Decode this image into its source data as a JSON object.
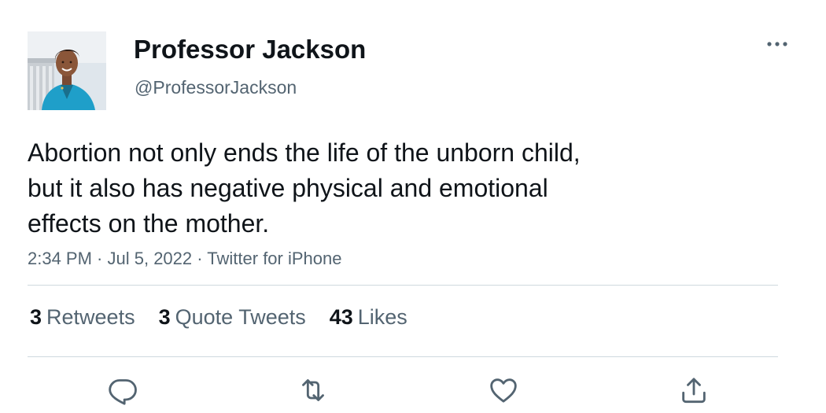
{
  "user": {
    "display_name": "Professor Jackson",
    "handle": "@ProfessorJackson"
  },
  "tweet": {
    "text": "Abortion not only ends the life of the unborn child,\nbut it also has negative physical and emotional\neffects on the mother.",
    "time": "2:34 PM",
    "date": "Jul 5, 2022",
    "source": "Twitter for iPhone",
    "separator": " · "
  },
  "stats": {
    "retweets_count": "3",
    "retweets_label": "Retweets",
    "quotes_count": "3",
    "quotes_label": "Quote Tweets",
    "likes_count": "43",
    "likes_label": "Likes"
  },
  "actions": [
    "reply-icon",
    "retweet-icon",
    "like-icon",
    "share-icon"
  ],
  "colors": {
    "text_primary": "#0f1419",
    "text_secondary": "#536471",
    "divider": "#cfd9de",
    "icon": "#536471"
  }
}
